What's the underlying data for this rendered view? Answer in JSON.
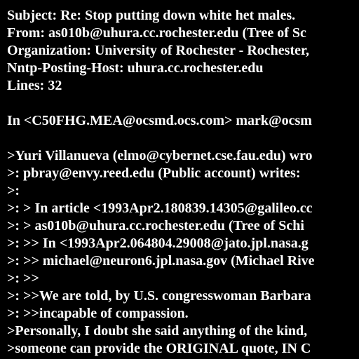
{
  "colors": {
    "background": "#000000",
    "text": "#ffffff"
  },
  "message": {
    "lines": [
      "Subject: Re: Stop putting down white het males.",
      "From: as010b@uhura.cc.rochester.edu (Tree of Sc",
      "Organization: University of Rochester - Rochester,",
      "Nntp-Posting-Host: uhura.cc.rochester.edu",
      "Lines: 32",
      "",
      "In <C50FHG.MEA@ocsmd.ocs.com> mark@ocsm",
      "",
      ">Yuri Villanueva (elmo@cybernet.cse.fau.edu) wro",
      ">: pbray@envy.reed.edu (Public account) writes:",
      ">:",
      ">: > In article <1993Apr2.180839.14305@galileo.cc",
      ">: > as010b@uhura.cc.rochester.edu (Tree of Schi",
      ">: >> In <1993Apr2.064804.29008@jato.jpl.nasa.g",
      ">: >> michael@neuron6.jpl.nasa.gov (Michael Rive",
      ">: >>",
      ">: >>We are told, by U.S. congresswoman Barbara",
      ">: >>incapable of compassion.",
      ">Personally, I doubt she said anything of the kind,",
      ">someone can provide the ORIGINAL quote, IN C"
    ]
  }
}
